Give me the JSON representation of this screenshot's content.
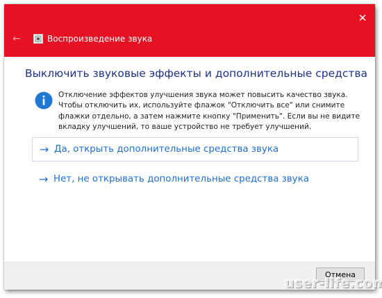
{
  "window": {
    "title": "Воспроизведение звука",
    "close_glyph": "✕",
    "back_glyph": "←",
    "accent_color": "#e81123"
  },
  "content": {
    "heading": "Выключить звуковые эффекты и дополнительные средства",
    "info_text": "Отключение эффектов улучшения звука может повысить качество звука. Чтобы отключить их, используйте флажок \"Отключить все\" или снимите флажки отдельно, а затем нажмите кнопку \"Применить\". Если вы не видите вкладку улучшений, то ваше устройство не требует улучшений.",
    "info_icon": "info-icon",
    "options": [
      {
        "arrow": "→",
        "label": "Да, открыть дополнительные средства звука"
      },
      {
        "arrow": "→",
        "label": "Нет, не открывать дополнительные средства звука"
      }
    ]
  },
  "footer": {
    "cancel_label": "Отмена"
  },
  "watermark": "user-life.com"
}
